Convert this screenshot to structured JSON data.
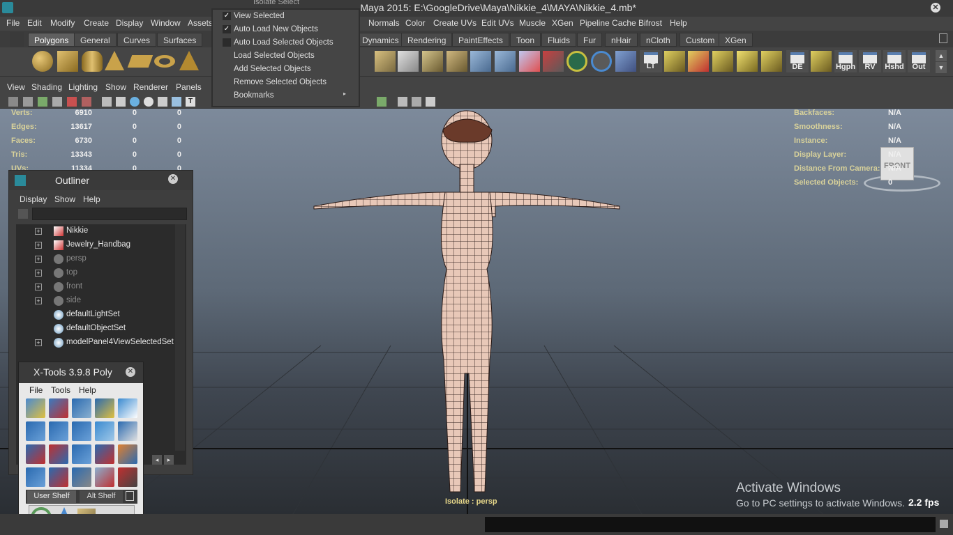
{
  "window": {
    "title": "Autodesk Maya 2015: E:\\GoogleDrive\\Maya\\Nikkie_4\\MAYA\\Nikkie_4.mb*"
  },
  "menubar": [
    "File",
    "Edit",
    "Modify",
    "Create",
    "Display",
    "Window",
    "Assets",
    "Normals",
    "Color",
    "Create UVs",
    "Edit UVs",
    "Muscle",
    "XGen",
    "Pipeline Cache",
    "Bifrost",
    "Help"
  ],
  "shelf_tabs": [
    "Polygons",
    "General",
    "Curves",
    "Surfaces",
    "Dynamics",
    "Rendering",
    "PaintEffects",
    "Toon",
    "Fluids",
    "Fur",
    "nHair",
    "nCloth",
    "Custom",
    "XGen"
  ],
  "shelf_labels": {
    "lt": "LT",
    "de": "DE",
    "hgph": "Hgph",
    "rv": "RV",
    "hshd": "Hshd",
    "out": "Out"
  },
  "panel_menu": [
    "View",
    "Shading",
    "Lighting",
    "Show",
    "Renderer",
    "Panels"
  ],
  "isolate_menu": {
    "title": "Isolate Select",
    "items": [
      {
        "label": "View Selected",
        "checked": true
      },
      {
        "label": "Auto Load New Objects",
        "checked": true
      },
      {
        "label": "Auto Load Selected Objects",
        "checked": false
      },
      {
        "label": "Load Selected Objects"
      },
      {
        "label": "Add Selected Objects"
      },
      {
        "label": "Remove Selected Objects"
      },
      {
        "label": "Bookmarks"
      }
    ]
  },
  "hud_left": [
    {
      "label": "Verts:",
      "v1": "6910",
      "v2": "0",
      "v3": "0"
    },
    {
      "label": "Edges:",
      "v1": "13617",
      "v2": "0",
      "v3": "0"
    },
    {
      "label": "Faces:",
      "v1": "6730",
      "v2": "0",
      "v3": "0"
    },
    {
      "label": "Tris:",
      "v1": "13343",
      "v2": "0",
      "v3": "0"
    },
    {
      "label": "UVs:",
      "v1": "11334",
      "v2": "0",
      "v3": "0"
    }
  ],
  "hud_right": [
    {
      "label": "Backfaces:",
      "value": "N/A"
    },
    {
      "label": "Smoothness:",
      "value": "N/A"
    },
    {
      "label": "Instance:",
      "value": "N/A"
    },
    {
      "label": "Display Layer:",
      "value": "N/A"
    },
    {
      "label": "Distance From Camera:",
      "value": "N/A"
    },
    {
      "label": "Selected Objects:",
      "value": "0"
    }
  ],
  "viewcube": {
    "label": "FRONT"
  },
  "outliner": {
    "title": "Outliner",
    "menu": [
      "Display",
      "Show",
      "Help"
    ],
    "items": [
      {
        "name": "Nikkie",
        "expandable": true,
        "dim": false,
        "icon": "mesh-icon"
      },
      {
        "name": "Jewelry_Handbag",
        "expandable": true,
        "dim": false,
        "icon": "mesh-icon"
      },
      {
        "name": "persp",
        "expandable": true,
        "dim": true,
        "icon": "camera-icon"
      },
      {
        "name": "top",
        "expandable": true,
        "dim": true,
        "icon": "camera-icon"
      },
      {
        "name": "front",
        "expandable": true,
        "dim": true,
        "icon": "camera-icon"
      },
      {
        "name": "side",
        "expandable": true,
        "dim": true,
        "icon": "camera-icon"
      },
      {
        "name": "defaultLightSet",
        "expandable": false,
        "dim": false,
        "icon": "set-icon"
      },
      {
        "name": "defaultObjectSet",
        "expandable": false,
        "dim": false,
        "icon": "set-icon"
      },
      {
        "name": "modelPanel4ViewSelectedSet",
        "expandable": true,
        "dim": false,
        "icon": "set-icon"
      }
    ]
  },
  "xtools": {
    "title": "X-Tools 3.9.8 Poly",
    "menu": [
      "File",
      "Tools",
      "Help"
    ],
    "tabs": [
      "User Shelf",
      "Alt Shelf"
    ]
  },
  "viewport": {
    "isolate_label": "Isolate : persp",
    "fps": "2.2 fps"
  },
  "watermark": {
    "line1": "Activate Windows",
    "line2": "Go to PC settings to activate Windows."
  },
  "colors": {
    "hud_label": "#d9d29a",
    "accent": "#5a7fb0"
  }
}
